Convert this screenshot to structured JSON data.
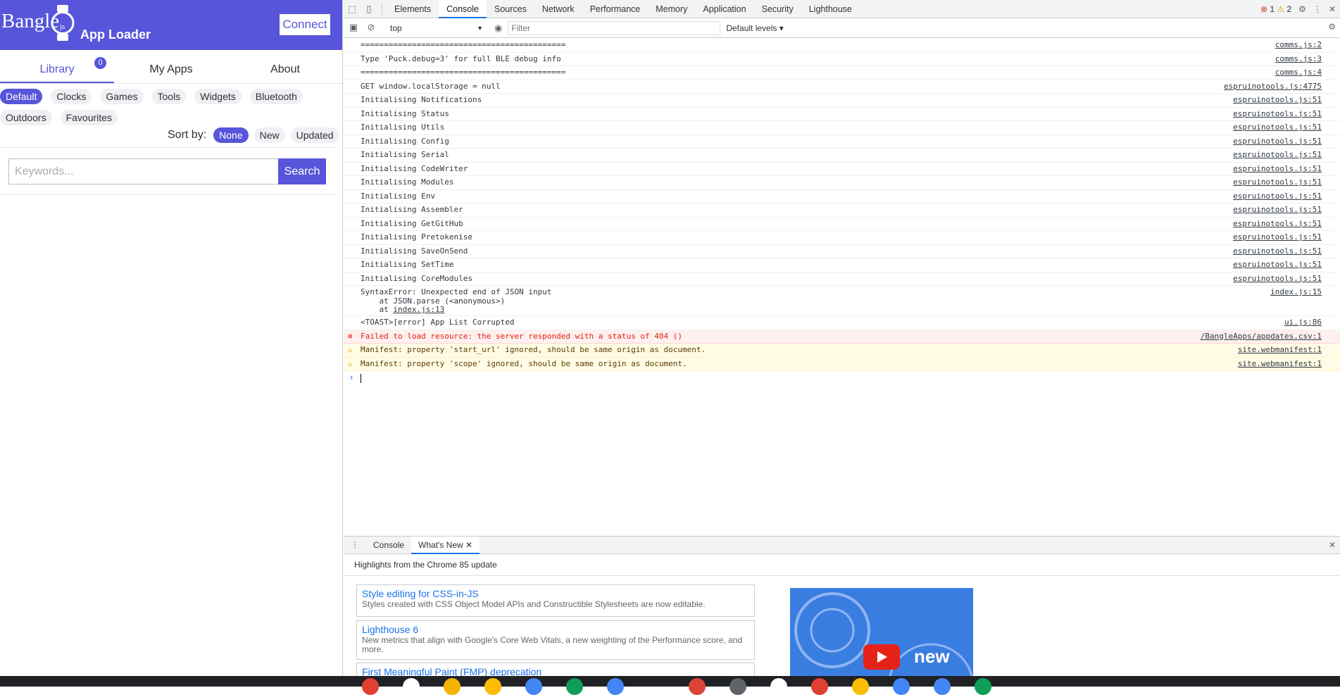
{
  "app": {
    "logo": "Bangle",
    "logo_sub": "js",
    "title": "App Loader",
    "connect_label": "Connect",
    "tabs": [
      {
        "label": "Library",
        "active": true,
        "badge": "0"
      },
      {
        "label": "My Apps",
        "active": false
      },
      {
        "label": "About",
        "active": false
      }
    ],
    "chips": [
      {
        "label": "Default",
        "active": true
      },
      {
        "label": "Clocks",
        "active": false
      },
      {
        "label": "Games",
        "active": false
      },
      {
        "label": "Tools",
        "active": false
      },
      {
        "label": "Widgets",
        "active": false
      },
      {
        "label": "Bluetooth",
        "active": false
      },
      {
        "label": "Outdoors",
        "active": false
      },
      {
        "label": "Favourites",
        "active": false
      }
    ],
    "sort": {
      "label": "Sort by:",
      "options": [
        {
          "label": "None",
          "active": true
        },
        {
          "label": "New",
          "active": false
        },
        {
          "label": "Updated",
          "active": false
        }
      ]
    },
    "search": {
      "placeholder": "Keywords...",
      "button": "Search"
    },
    "accent_color": "#5755d9"
  },
  "devtools": {
    "tabs": [
      "Elements",
      "Console",
      "Sources",
      "Network",
      "Performance",
      "Memory",
      "Application",
      "Security",
      "Lighthouse"
    ],
    "active_tab": "Console",
    "error_count": "1",
    "warning_count": "2",
    "context": "top",
    "filter_placeholder": "Filter",
    "levels": "Default levels ▾",
    "console": [
      {
        "text": "============================================",
        "src": "comms.js:2",
        "level": "log"
      },
      {
        "text": "Type 'Puck.debug=3' for full BLE debug info",
        "src": "comms.js:3",
        "level": "log"
      },
      {
        "text": "============================================",
        "src": "comms.js:4",
        "level": "log"
      },
      {
        "text": "GET window.localStorage = null",
        "src": "espruinotools.js:4775",
        "level": "log"
      },
      {
        "text": "Initialising Notifications",
        "src": "espruinotools.js:51",
        "level": "log"
      },
      {
        "text": "Initialising Status",
        "src": "espruinotools.js:51",
        "level": "log"
      },
      {
        "text": "Initialising Utils",
        "src": "espruinotools.js:51",
        "level": "log"
      },
      {
        "text": "Initialising Config",
        "src": "espruinotools.js:51",
        "level": "log"
      },
      {
        "text": "Initialising Serial",
        "src": "espruinotools.js:51",
        "level": "log"
      },
      {
        "text": "Initialising CodeWriter",
        "src": "espruinotools.js:51",
        "level": "log"
      },
      {
        "text": "Initialising Modules",
        "src": "espruinotools.js:51",
        "level": "log"
      },
      {
        "text": "Initialising Env",
        "src": "espruinotools.js:51",
        "level": "log"
      },
      {
        "text": "Initialising Assembler",
        "src": "espruinotools.js:51",
        "level": "log"
      },
      {
        "text": "Initialising GetGitHub",
        "src": "espruinotools.js:51",
        "level": "log"
      },
      {
        "text": "Initialising Pretokenise",
        "src": "espruinotools.js:51",
        "level": "log"
      },
      {
        "text": "Initialising SaveOnSend",
        "src": "espruinotools.js:51",
        "level": "log"
      },
      {
        "text": "Initialising SetTime",
        "src": "espruinotools.js:51",
        "level": "log"
      },
      {
        "text": "Initialising CoreModules",
        "src": "espruinotools.js:51",
        "level": "log"
      }
    ],
    "syntax_error": {
      "line1": "SyntaxError: Unexpected end of JSON input",
      "line2": "    at JSON.parse (<anonymous>)",
      "line3_prefix": "    at ",
      "line3_link": "index.js:13",
      "src": "index.js:15"
    },
    "console_tail": [
      {
        "text": "<TOAST>[error] App List Corrupted",
        "src": "ui.js:86",
        "level": "log"
      },
      {
        "text": "Failed to load resource: the server responded with a status of 404 ()",
        "src": "/BangleApps/appdates.csv:1",
        "level": "error"
      },
      {
        "text": "Manifest: property 'start_url' ignored, should be same origin as document.",
        "src": "site.webmanifest:1",
        "level": "warning"
      },
      {
        "text": "Manifest: property 'scope' ignored, should be same origin as document.",
        "src": "site.webmanifest:1",
        "level": "warning"
      }
    ],
    "drawer": {
      "tabs": [
        "Console",
        "What's New"
      ],
      "active_tab": "What's New",
      "heading": "Highlights from the Chrome 85 update",
      "cards": [
        {
          "title": "Style editing for CSS-in-JS",
          "desc": "Styles created with CSS Object Model APIs and Constructible Stylesheets are now editable."
        },
        {
          "title": "Lighthouse 6",
          "desc": "New metrics that align with Google's Core Web Vitals, a new weighting of the Performance score, and more."
        },
        {
          "title": "First Meaningful Paint (FMP) deprecation",
          "desc": ""
        }
      ],
      "video_text": "new"
    }
  }
}
